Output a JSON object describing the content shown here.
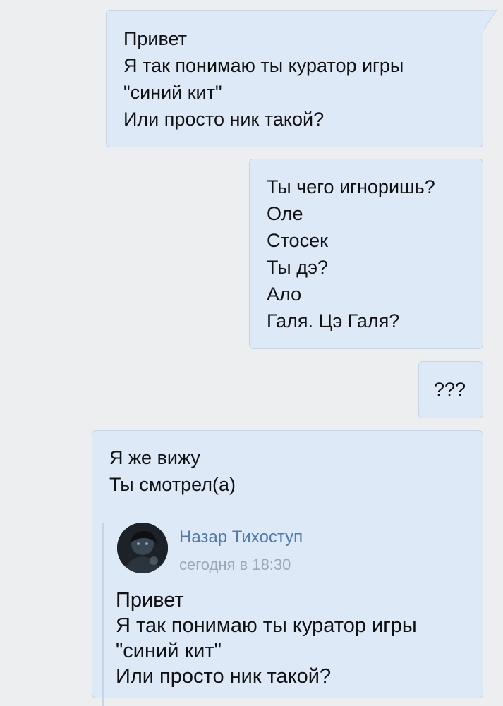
{
  "messages": [
    {
      "lines": [
        "Привет",
        "Я так понимаю ты куратор игры",
        "\"синий кит\"",
        "Или просто ник такой?"
      ]
    },
    {
      "lines": [
        "Ты чего игноришь?",
        "Оле",
        "Стосек",
        "Ты дэ?",
        "Ало",
        "Галя. Цэ Галя?"
      ]
    },
    {
      "lines": [
        "???"
      ]
    },
    {
      "lines": [
        "Я же вижу",
        "Ты смотрел(а)"
      ],
      "forwarded": {
        "author": "Назар Тихоступ",
        "time": "сегодня в 18:30",
        "avatar_icon": "user-avatar-photo",
        "lines": [
          "Привет",
          "Я так понимаю ты куратор игры",
          "\"синий кит\"",
          "Или просто ник такой?"
        ]
      }
    }
  ],
  "colors": {
    "background": "#edeef0",
    "bubble": "#dde9f7",
    "bubble_border": "#c5d4e6",
    "author_name": "#4f7aa9",
    "time": "#9aa8b8"
  }
}
